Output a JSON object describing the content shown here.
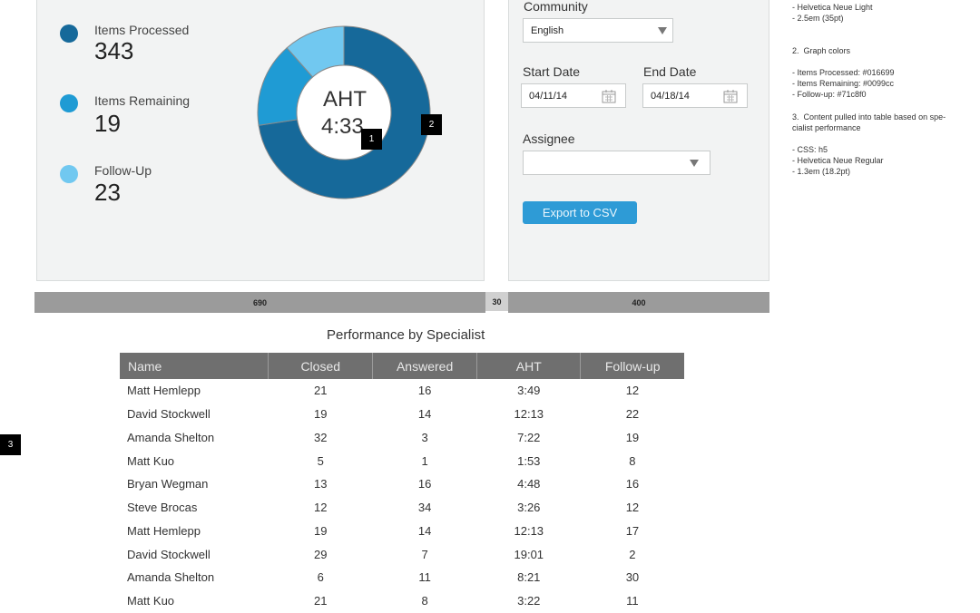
{
  "summary": {
    "items": [
      {
        "label": "Items Processed",
        "value": "343",
        "color": "#16699a"
      },
      {
        "label": "Items Remaining",
        "value": "19",
        "color": "#1f9bd4"
      },
      {
        "label": "Follow-Up",
        "value": "23",
        "color": "#71c8f0"
      }
    ],
    "donut": {
      "center_title": "AHT",
      "center_value": "4:33",
      "segments": [
        {
          "name": "Items Processed",
          "fraction": 0.726,
          "color": "#16699a"
        },
        {
          "name": "Items Remaining",
          "fraction": 0.159,
          "color": "#1f9bd4"
        },
        {
          "name": "Follow-Up",
          "fraction": 0.115,
          "color": "#71c8f0"
        }
      ]
    }
  },
  "filters": {
    "community_label": "Community",
    "community_value": "English",
    "start_label": "Start Date",
    "start_value": "04/11/14",
    "end_label": "End Date",
    "end_value": "04/18/14",
    "assignee_label": "Assignee",
    "assignee_value": "",
    "export_label": "Export to CSV"
  },
  "measurements": {
    "left": "690",
    "gap": "30",
    "right": "400"
  },
  "callouts": {
    "one": "1",
    "two": "2",
    "three": "3"
  },
  "notes": {
    "block1": "- Helvetica Neue Light\n- 2.5em (35pt)",
    "block2": "2.  Graph colors",
    "block3": "- Items Processed: #016699\n- Items Remaining: #0099cc\n- Follow-up: #71c8f0",
    "block4": "3.  Content pulled into table based on spe-\ncialist performance",
    "block5": "- CSS: h5\n- Helvetica Neue Regular\n- 1.3em (18.2pt)"
  },
  "table": {
    "title": "Performance by Specialist",
    "headers": [
      "Name",
      "Closed",
      "Answered",
      "AHT",
      "Follow-up"
    ],
    "rows": [
      [
        "Matt Hemlepp",
        "21",
        "16",
        "3:49",
        "12"
      ],
      [
        "David Stockwell",
        "19",
        "14",
        "12:13",
        "22"
      ],
      [
        "Amanda Shelton",
        "32",
        "3",
        "7:22",
        "19"
      ],
      [
        "Matt Kuo",
        "5",
        "1",
        "1:53",
        "8"
      ],
      [
        "Bryan Wegman",
        "13",
        "16",
        "4:48",
        "16"
      ],
      [
        "Steve Brocas",
        "12",
        "34",
        "3:26",
        "12"
      ],
      [
        "Matt Hemlepp",
        "19",
        "14",
        "12:13",
        "17"
      ],
      [
        "David Stockwell",
        "29",
        "7",
        "19:01",
        "2"
      ],
      [
        "Amanda Shelton",
        "6",
        "11",
        "8:21",
        "30"
      ],
      [
        "Matt Kuo",
        "21",
        "8",
        "3:22",
        "11"
      ]
    ]
  }
}
